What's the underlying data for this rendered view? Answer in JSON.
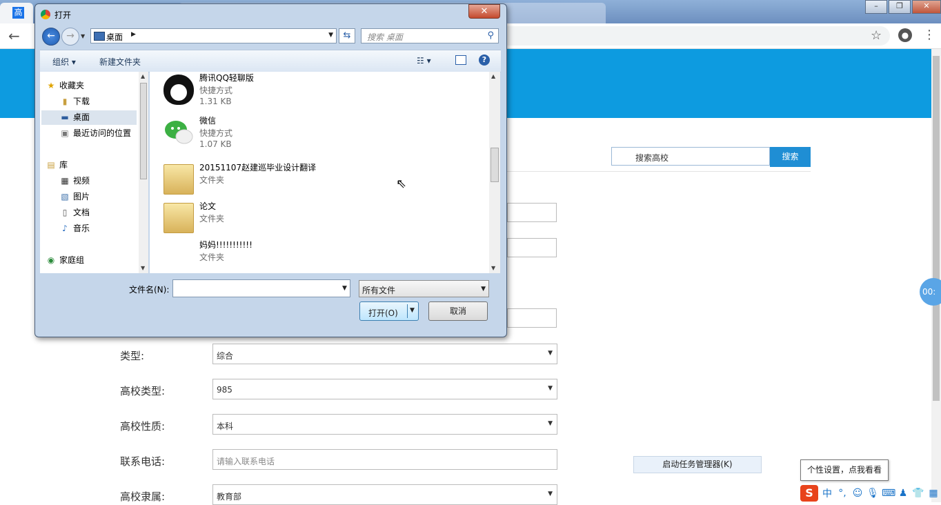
{
  "browser": {
    "tab_favicon": "高",
    "window_buttons": {
      "minimize": "–",
      "maximize": "❐",
      "close": "✕"
    },
    "icons": {
      "back": "back-arrow-icon",
      "star": "star-icon",
      "account": "account-icon",
      "menu": "menu-icon"
    }
  },
  "page": {
    "search_placeholder": "搜索高校",
    "search_button": "搜索",
    "fields": [
      {
        "label": "类型:",
        "value": "综合",
        "kind": "select"
      },
      {
        "label": "高校类型:",
        "value": "985",
        "kind": "select"
      },
      {
        "label": "高校性质:",
        "value": "本科",
        "kind": "select"
      },
      {
        "label": "联系电话:",
        "placeholder": "请输入联系电话",
        "kind": "input"
      },
      {
        "label": "高校隶属:",
        "value": "教育部",
        "kind": "select"
      }
    ],
    "taskmgr_button": "启动任务管理器(K)",
    "tooltip": "个性设置，点我看看",
    "timer_text": "00:",
    "ime": {
      "logo": "S",
      "mode": "中",
      "punct": "°,",
      "icons": [
        "smile-icon",
        "mic-icon",
        "keyboard-icon",
        "user-icon",
        "shirt-icon",
        "grid-icon"
      ]
    }
  },
  "dialog": {
    "title": "打开",
    "close": "✕",
    "address": "桌面",
    "search_placeholder": "搜索 桌面",
    "organize": "组织 ▾",
    "new_folder": "新建文件夹",
    "help": "?",
    "nav": {
      "favorites": "收藏夹",
      "downloads": "下载",
      "desktop": "桌面",
      "recent": "最近访问的位置",
      "libraries": "库",
      "videos": "视频",
      "pictures": "图片",
      "documents": "文档",
      "music": "音乐",
      "homegroup": "家庭组"
    },
    "files": [
      {
        "name": "腾讯QQ轻聊版",
        "type": "快捷方式",
        "size": "1.31 KB",
        "icon": "qq-icon"
      },
      {
        "name": "微信",
        "type": "快捷方式",
        "size": "1.07 KB",
        "icon": "wechat-icon"
      },
      {
        "name": "20151107赵建巡毕业设计翻译",
        "type": "文件夹",
        "size": "",
        "icon": "folder-icon"
      },
      {
        "name": "论文",
        "type": "文件夹",
        "size": "",
        "icon": "folder-icon"
      },
      {
        "name": "妈妈!!!!!!!!!!!",
        "type": "文件夹",
        "size": "",
        "icon": "folder-icon"
      }
    ],
    "filename_label": "文件名(N):",
    "filename_value": "",
    "filetype": "所有文件",
    "open_button": "打开(O)",
    "cancel_button": "取消"
  }
}
